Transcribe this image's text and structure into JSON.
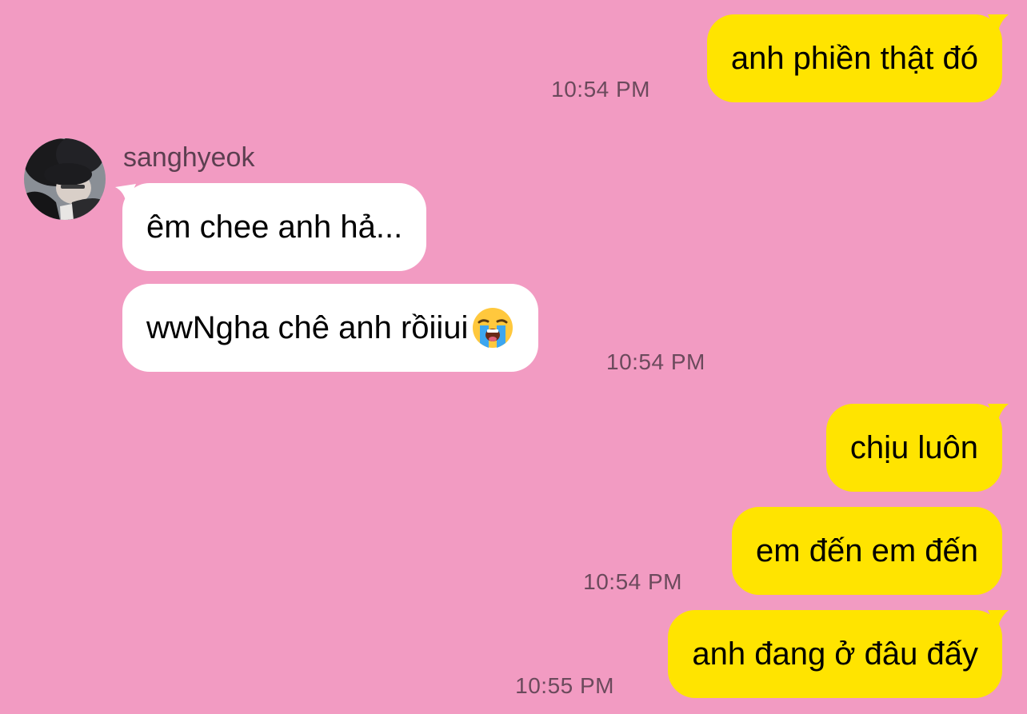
{
  "colors": {
    "background": "#F29BC2",
    "sent_bubble": "#FFE400",
    "received_bubble": "#FFFFFF",
    "timestamp": "#6B4A5C",
    "sender_name": "#5C3F50"
  },
  "contact": {
    "name": "sanghyeok",
    "avatar_icon": "profile-photo"
  },
  "messages": [
    {
      "direction": "sent",
      "text": "anh phiền thật đó",
      "time": "10:54 PM"
    },
    {
      "direction": "received",
      "text": "êm chee anh hả...",
      "time": ""
    },
    {
      "direction": "received",
      "text": "wwNgha chê anh rồiiui",
      "emoji": "loudly-crying-face-icon",
      "time": "10:54 PM"
    },
    {
      "direction": "sent",
      "text": "chịu luôn",
      "time": ""
    },
    {
      "direction": "sent",
      "text": "em đến em đến",
      "time": "10:54 PM"
    },
    {
      "direction": "sent",
      "text": "anh đang ở đâu đấy",
      "time": "10:55 PM"
    }
  ]
}
